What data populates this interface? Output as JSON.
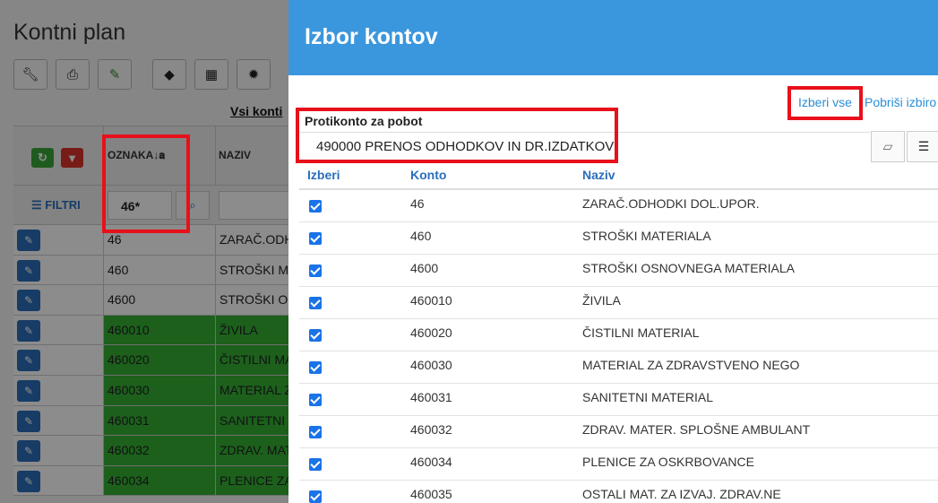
{
  "background": {
    "page_title": "Kontni plan",
    "toolbar_icons": [
      "wrench-icon",
      "print-icon",
      "pencil-icon",
      "tags-icon",
      "calendar-icon",
      "gear-icon"
    ],
    "vsi_konti_label": "Vsi konti",
    "grid": {
      "col_oznaka": "OZNAKA",
      "col_naziv": "NAZIV",
      "filtri_label": "FILTRI",
      "filter_value": "46*",
      "rows": [
        {
          "oznaka": "46",
          "naziv": "ZARAČ.ODHODKI DOL.UPOR.",
          "highlight": false
        },
        {
          "oznaka": "460",
          "naziv": "STROŠKI MATERIALA",
          "highlight": false
        },
        {
          "oznaka": "4600",
          "naziv": "STROŠKI OSNOVNEGA MATERIALA",
          "highlight": false
        },
        {
          "oznaka": "460010",
          "naziv": "ŽIVILA",
          "highlight": true
        },
        {
          "oznaka": "460020",
          "naziv": "ČISTILNI MATERIAL",
          "highlight": true
        },
        {
          "oznaka": "460030",
          "naziv": "MATERIAL ZA ZDRAVSTVENO NEGO",
          "highlight": true
        },
        {
          "oznaka": "460031",
          "naziv": "SANITETNI MATERIAL",
          "highlight": true
        },
        {
          "oznaka": "460032",
          "naziv": "ZDRAV. MATER. SPLOŠNE AMBULANT",
          "highlight": true
        },
        {
          "oznaka": "460034",
          "naziv": "PLENICE ZA OSKRBOVANCE",
          "highlight": true
        }
      ]
    },
    "colors": {
      "highlight": "#33b033",
      "edit_button": "#2a6ebb"
    }
  },
  "modal": {
    "title": "Izbor kontov",
    "izberi_vse": "Izberi vse",
    "pobrisi_izbiro": "Pobriši izbiro",
    "protikonto_label": "Protikonto za pobot",
    "protikonto_value": "490000 PRENOS ODHODKOV IN DR.IZDATKOV",
    "columns": {
      "izberi": "Izberi",
      "konto": "Konto",
      "naziv": "Naziv"
    },
    "rows": [
      {
        "checked": true,
        "konto": "46",
        "naziv": "ZARAČ.ODHODKI DOL.UPOR."
      },
      {
        "checked": true,
        "konto": "460",
        "naziv": "STROŠKI MATERIALA"
      },
      {
        "checked": true,
        "konto": "4600",
        "naziv": "STROŠKI OSNOVNEGA MATERIALA"
      },
      {
        "checked": true,
        "konto": "460010",
        "naziv": "ŽIVILA"
      },
      {
        "checked": true,
        "konto": "460020",
        "naziv": "ČISTILNI MATERIAL"
      },
      {
        "checked": true,
        "konto": "460030",
        "naziv": "MATERIAL ZA ZDRAVSTVENO NEGO"
      },
      {
        "checked": true,
        "konto": "460031",
        "naziv": "SANITETNI MATERIAL"
      },
      {
        "checked": true,
        "konto": "460032",
        "naziv": "ZDRAV. MATER. SPLOŠNE AMBULANT"
      },
      {
        "checked": true,
        "konto": "460034",
        "naziv": "PLENICE ZA OSKRBOVANCE"
      },
      {
        "checked": true,
        "konto": "460035",
        "naziv": "OSTALI MAT. ZA IZVAJ. ZDRAV.NE"
      }
    ],
    "colors": {
      "header": "#3b97dd",
      "link": "#2a8dd4",
      "checkbox": "#1a73e8",
      "annotation": "#e8101a"
    }
  }
}
